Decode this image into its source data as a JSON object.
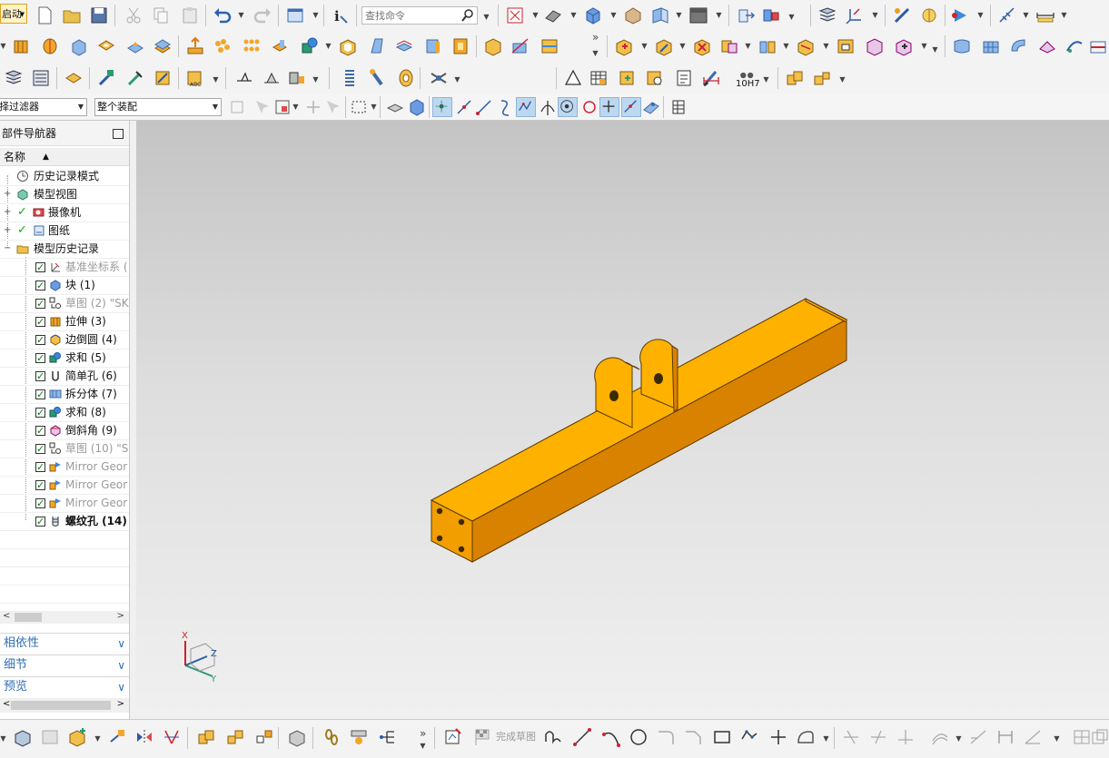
{
  "toolbar": {
    "start_label": "启动",
    "search_placeholder": "查找命令",
    "filter_select": "择过滤器",
    "assembly_select": "整个装配",
    "fit_label": "10H7"
  },
  "navigator": {
    "title": "部件导航器",
    "column_header": "名称",
    "top_items": [
      {
        "label": "历史记录模式",
        "icon": "clock-icon"
      },
      {
        "label": "模型视图",
        "icon": "model-views-icon"
      },
      {
        "label": "摄像机",
        "icon": "camera-icon"
      },
      {
        "label": "图纸",
        "icon": "drawing-icon"
      },
      {
        "label": "模型历史记录",
        "icon": "folder-icon"
      }
    ],
    "history": [
      {
        "label": "基准坐标系 (",
        "icon": "datum-csys-icon",
        "dim": true
      },
      {
        "label": "块 (1)",
        "icon": "block-icon",
        "dim": false
      },
      {
        "label": "草图 (2) \"SK",
        "icon": "sketch-icon",
        "dim": true
      },
      {
        "label": "拉伸 (3)",
        "icon": "extrude-icon",
        "dim": false
      },
      {
        "label": "边倒圆 (4)",
        "icon": "edge-blend-icon",
        "dim": false
      },
      {
        "label": "求和 (5)",
        "icon": "unite-icon",
        "dim": false
      },
      {
        "label": "简单孔 (6)",
        "icon": "simple-hole-icon",
        "dim": false
      },
      {
        "label": "拆分体 (7)",
        "icon": "split-body-icon",
        "dim": false
      },
      {
        "label": "求和 (8)",
        "icon": "unite-icon",
        "dim": false
      },
      {
        "label": "倒斜角 (9)",
        "icon": "chamfer-icon",
        "dim": false
      },
      {
        "label": "草图 (10) \"SI",
        "icon": "sketch-icon",
        "dim": true
      },
      {
        "label": "Mirror Geor",
        "icon": "mirror-geometry-icon",
        "dim": true
      },
      {
        "label": "Mirror Geor",
        "icon": "mirror-geometry-icon",
        "dim": true
      },
      {
        "label": "Mirror Geor",
        "icon": "mirror-geometry-icon",
        "dim": true
      },
      {
        "label": "螺纹孔 (14)",
        "icon": "threaded-hole-icon",
        "dim": false,
        "bold": true
      }
    ],
    "sections": [
      "相依性",
      "细节",
      "预览"
    ]
  },
  "sketch": {
    "finish_label": "完成草图"
  },
  "triad": {
    "x": "X",
    "y": "Y",
    "z": "Z"
  },
  "colors": {
    "part_top": "#FFB100",
    "part_side": "#F29E00",
    "part_front": "#D98200",
    "accent_blue": "#2f6fb5"
  }
}
